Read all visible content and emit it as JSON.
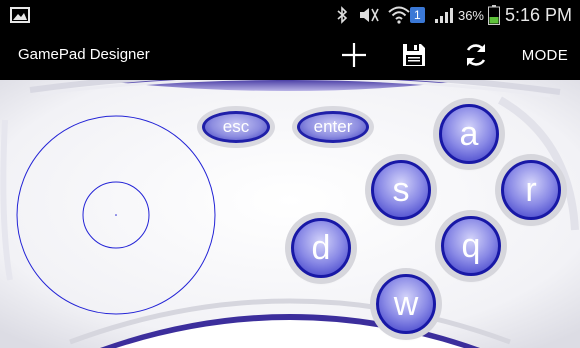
{
  "status_bar": {
    "bluetooth_icon": "bluetooth-icon",
    "mute_icon": "mute-icon",
    "wifi_icon": "wifi-icon",
    "sim_badge": "1",
    "signal_icon": "signal-icon",
    "battery_percent": "36%",
    "battery_icon": "battery-icon",
    "time": "5:16 PM"
  },
  "action_bar": {
    "title": "GamePad Designer",
    "add_icon": "plus-icon",
    "save_icon": "floppy-disk-icon",
    "refresh_icon": "refresh-icon",
    "mode_label": "MODE"
  },
  "gamepad": {
    "keys": {
      "esc": "esc",
      "enter": "enter",
      "a": "a",
      "s": "s",
      "r": "r",
      "d": "d",
      "q": "q",
      "w": "w"
    }
  },
  "colors": {
    "key_dark": "#1f1fa8",
    "key_light": "#c9c9f5",
    "joystick_stroke": "#2323d6",
    "background": "#f6f6f9"
  }
}
